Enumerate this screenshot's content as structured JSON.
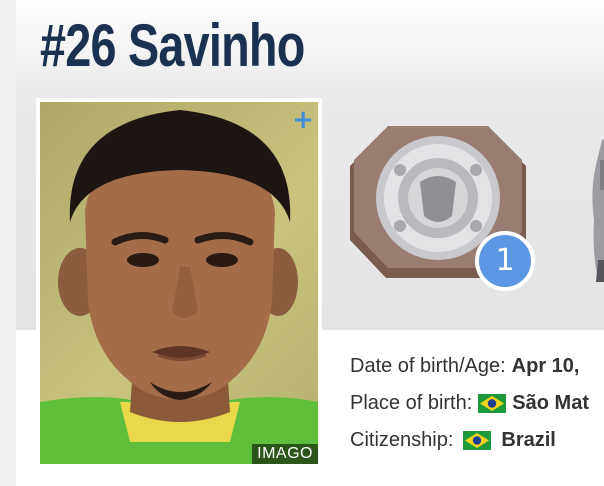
{
  "player": {
    "title": "#26 Savinho",
    "photo_credit": "IMAGO",
    "photo_expand_icon": "plus-icon"
  },
  "trophies": [
    {
      "name": "shield-trophy-icon",
      "count": "1"
    },
    {
      "name": "cup-trophy-icon"
    }
  ],
  "info": {
    "dob_label": "Date of birth/Age:",
    "dob_value": "Apr 10,",
    "birthplace_label": "Place of birth:",
    "birthplace_value": "São Mat",
    "citizenship_label": "Citizenship:",
    "citizenship_value": "Brazil"
  },
  "colors": {
    "title": "#1a3151",
    "badge": "#5b97e2",
    "plus": "#3b8fd9"
  }
}
